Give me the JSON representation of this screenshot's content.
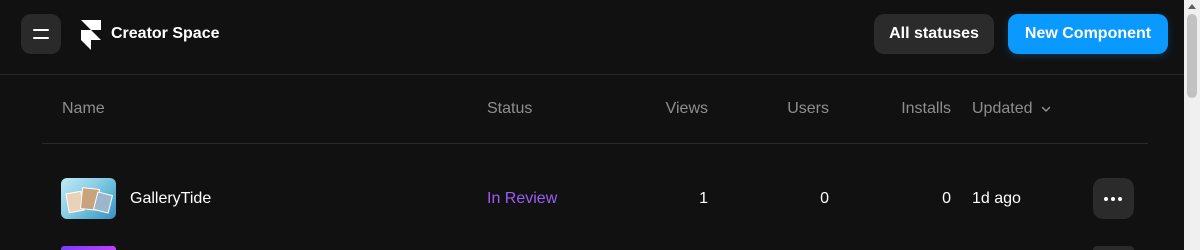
{
  "header": {
    "brand": "Creator Space",
    "filter_label": "All statuses",
    "new_button_label": "New Component"
  },
  "table": {
    "columns": {
      "name": "Name",
      "status": "Status",
      "views": "Views",
      "users": "Users",
      "installs": "Installs",
      "updated": "Updated"
    },
    "rows": [
      {
        "name": "GalleryTide",
        "status": "In Review",
        "views": "1",
        "users": "0",
        "installs": "0",
        "updated": "1d ago"
      }
    ]
  },
  "colors": {
    "background": "#111111",
    "accent_blue": "#0a99ff",
    "status_in_review": "#9b5cf6"
  },
  "icons": [
    "menu-icon",
    "framer-logo-icon",
    "chevron-down-icon",
    "more-horizontal-icon"
  ]
}
